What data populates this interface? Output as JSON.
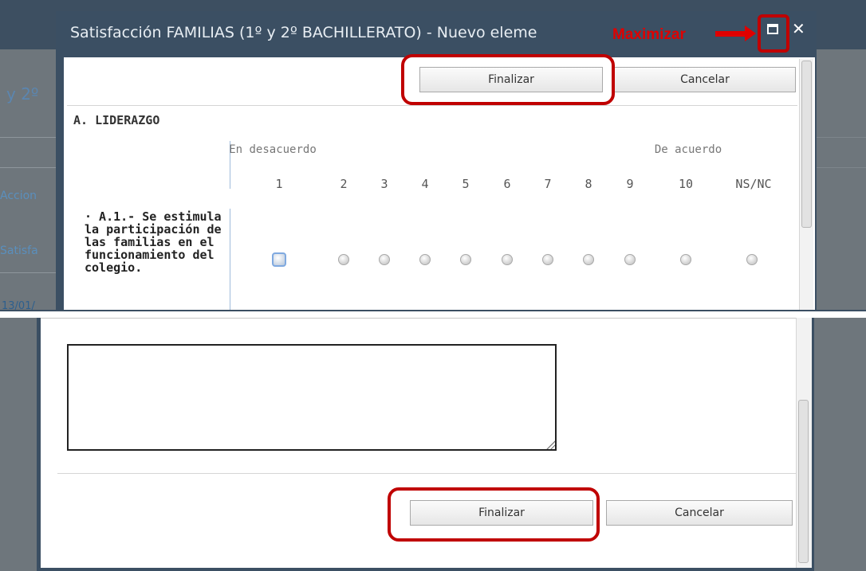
{
  "dialog": {
    "title": "Satisfacción FAMILIAS (1º y 2º BACHILLERATO) - Nuevo eleme",
    "maximize_annotation": "Maximizar",
    "close_glyph": "✕"
  },
  "toolbar": {
    "finalize_label": "Finalizar",
    "cancel_label": "Cancelar"
  },
  "background": {
    "title_fragment": "y 2º",
    "acciones_fragment": "Accion",
    "satisfa_fragment": "Satisfa",
    "date_fragment": "13/01/"
  },
  "form": {
    "section_title": "A. LIDERAZGO",
    "scale_low_label": "En desacuerdo",
    "scale_high_label": "De acuerdo",
    "columns": [
      "1",
      "2",
      "3",
      "4",
      "5",
      "6",
      "7",
      "8",
      "9",
      "10",
      "NS/NC"
    ],
    "question": "· A.1.- Se estimula la participación de las familias en el funcionamiento del colegio."
  },
  "bottom": {
    "finalize_label": "Finalizar",
    "cancel_label": "Cancelar",
    "comment_value": ""
  },
  "colors": {
    "dialog_frame": "#3b4f63",
    "highlight": "#c00000",
    "annotation_red": "#e00000"
  }
}
